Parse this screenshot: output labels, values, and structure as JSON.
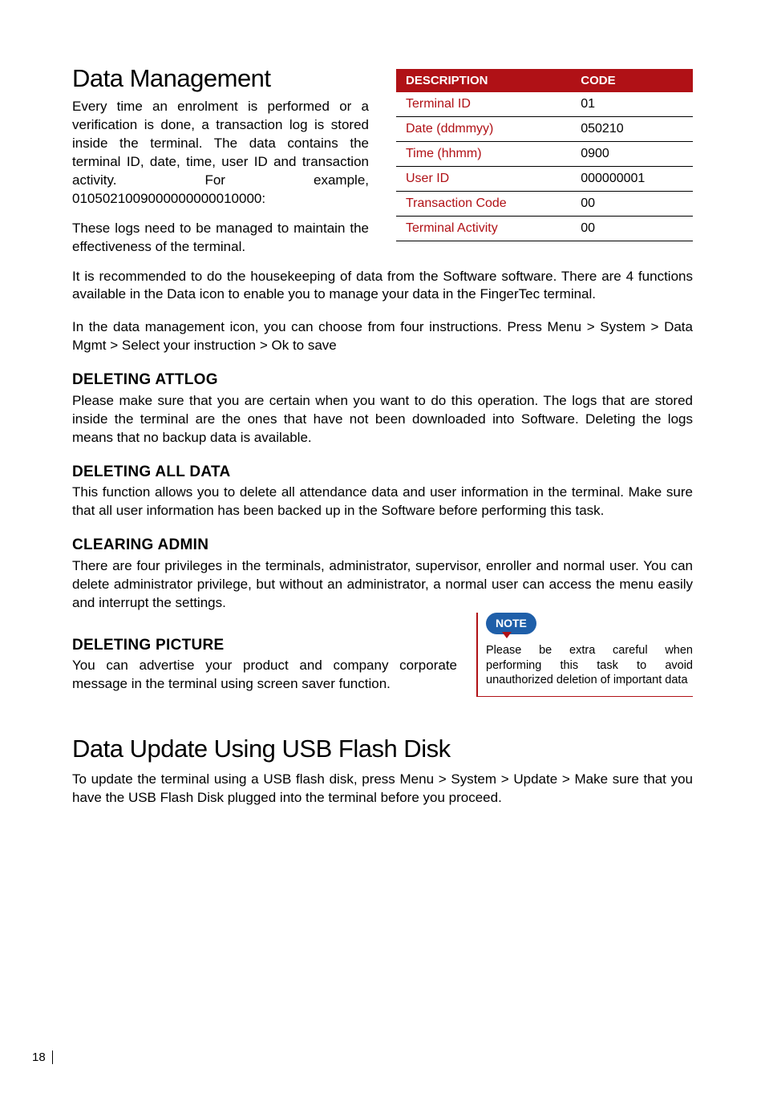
{
  "h1a": "Data Management",
  "intro1": "Every time an enrolment is performed or a verification is done, a transaction log is stored inside the terminal. The data contains the terminal ID, date, time, user ID and transaction activity. For example, 0105021009000000000010000:",
  "intro2": "These logs need to be managed to maintain the effectiveness of the terminal.",
  "table": {
    "h1": "DESCRIPTION",
    "h2": "CODE",
    "rows": [
      {
        "d": "Terminal ID",
        "c": "01"
      },
      {
        "d": "Date (ddmmyy)",
        "c": "050210"
      },
      {
        "d": "Time (hhmm)",
        "c": "0900"
      },
      {
        "d": "User ID",
        "c": "000000001"
      },
      {
        "d": "Transaction Code",
        "c": "00"
      },
      {
        "d": "Terminal Activity",
        "c": "00"
      }
    ]
  },
  "p_full1": "It is recommended to do the housekeeping of data from the Software software. There are 4 functions available in the Data icon to enable you to manage your data in the FingerTec terminal.",
  "p_full2": "In the data management icon, you can choose from four instructions. Press Menu > System > Data Mgmt > Select your instruction > Ok to save",
  "s1h": "DELETING ATTLOG",
  "s1p": "Please make sure that you are certain when you want to do this operation. The logs that are stored inside the terminal are the ones that have not been downloaded into Software. Deleting the logs means that no backup data is available.",
  "s2h": "DELETING ALL DATA",
  "s2p": "This function allows you to delete all attendance data and user information in the terminal. Make sure that all user information has been backed up in the Software before performing this task.",
  "s3h": "CLEARING ADMIN",
  "s3p": "There are four privileges in the terminals, administrator, supervisor, enroller and normal user. You can delete administrator privilege, but without an administrator, a normal user can access the menu easily and interrupt the settings.",
  "s4h": "DELETING PICTURE",
  "s4p": "You can advertise your product and company corporate message in the terminal using screen saver function.",
  "note_label": "NOTE",
  "note_text": "Please be extra careful when performing this task to avoid unauthorized deletion of important data",
  "h1b": "Data Update Using USB  Flash Disk",
  "p_usb": "To update the terminal using a USB flash disk, press Menu > System > Update > Make sure that you have the USB Flash Disk plugged into the terminal before you proceed.",
  "page": "18"
}
